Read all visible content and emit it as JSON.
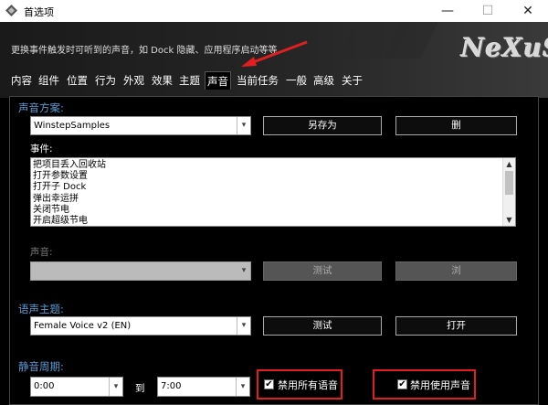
{
  "window": {
    "title": "首选项",
    "min_glyph": "—",
    "max_glyph": "☐",
    "close_glyph": "✕"
  },
  "header": {
    "description": "更换事件触发时可听到的声音，如 Dock 隐藏、应用程序启动等等",
    "logo": "NeXuS"
  },
  "tabs": [
    "内容",
    "组件",
    "位置",
    "行为",
    "外观",
    "效果",
    "主题",
    "声音",
    "当前任务",
    "一般",
    "高级",
    "关于"
  ],
  "active_tab": "声音",
  "sound_scheme": {
    "section_label": "声音方案:",
    "value": "WinstepSamples",
    "save_as_label": "另存为",
    "delete_label": "删"
  },
  "events": {
    "label": "事件:",
    "items": [
      "把项目丢入回收站",
      "打开参数设置",
      "打开子 Dock",
      "弹出幸运拼",
      "关闭节电",
      "开启超级节电"
    ]
  },
  "sound": {
    "label": "声音:",
    "value": "",
    "test_label": "测试",
    "browse_label": "浏"
  },
  "voice_theme": {
    "section_label": "语声主题:",
    "value": "Female Voice v2 (EN)",
    "test_label": "测试",
    "open_label": "打开"
  },
  "quiet_period": {
    "section_label": "静音周期:",
    "from_value": "0:00",
    "to_label": "到",
    "to_value": "7:00",
    "disable_all_voice_label": "禁用所有语音",
    "disable_sound_label": "禁用使用声音",
    "disable_all_voice_checked": true,
    "disable_sound_checked": true
  },
  "colors": {
    "accent": "#5b9bd5",
    "highlight": "#e02020"
  },
  "icons": {
    "app": "diamond-icon",
    "dropdown": "chevron-down-icon",
    "annotation": "red-arrow-icon"
  }
}
